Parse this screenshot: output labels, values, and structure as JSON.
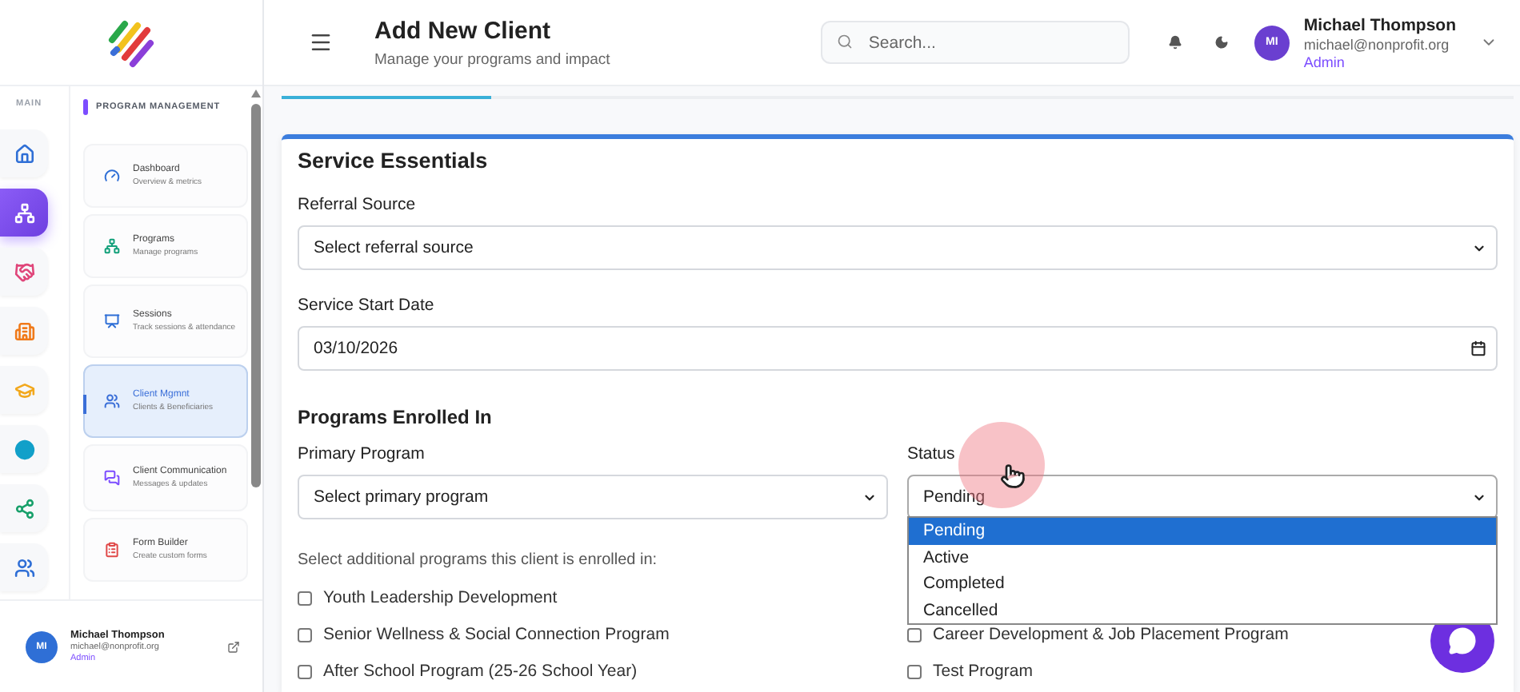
{
  "rail": {
    "label": "MAIN",
    "items": [
      {
        "kind": "home",
        "selected": false
      },
      {
        "kind": "programs",
        "selected": true
      },
      {
        "kind": "handshake",
        "selected": false
      },
      {
        "kind": "building",
        "selected": false
      },
      {
        "kind": "education",
        "selected": false
      },
      {
        "kind": "globe",
        "selected": false
      },
      {
        "kind": "network",
        "selected": false
      },
      {
        "kind": "people",
        "selected": false
      }
    ]
  },
  "nav": {
    "heading": "PROGRAM MANAGEMENT",
    "items": [
      {
        "kind": "dashboard",
        "title": "Dashboard",
        "subtitle": "Overview & metrics",
        "selected": false
      },
      {
        "kind": "programs",
        "title": "Programs",
        "subtitle": "Manage programs",
        "selected": false
      },
      {
        "kind": "sessions",
        "title": "Sessions",
        "subtitle": "Track sessions & attendance",
        "selected": false
      },
      {
        "kind": "clients",
        "title": "Client Mgmnt",
        "subtitle": "Clients & Beneficiaries",
        "selected": true
      },
      {
        "kind": "communication",
        "title": "Client Communication",
        "subtitle": "Messages & updates",
        "selected": false
      },
      {
        "kind": "forms",
        "title": "Form Builder",
        "subtitle": "Create custom forms",
        "selected": false
      }
    ]
  },
  "sidebar_user": {
    "initials": "MI",
    "name": "Michael Thompson",
    "email": "michael@nonprofit.org",
    "role": "Admin"
  },
  "header": {
    "title": "Add New Client",
    "subtitle": "Manage your programs and impact",
    "search": {
      "placeholder": "Search..."
    },
    "user": {
      "initials": "MI",
      "name": "Michael Thompson",
      "email": "michael@nonprofit.org",
      "role": "Admin"
    }
  },
  "progress": {
    "level": 0.17
  },
  "card": {
    "title": "Service Essentials",
    "referral": {
      "label": "Referral Source",
      "placeholder": "Select referral source"
    },
    "start_date": {
      "label": "Service Start Date",
      "value": "03/10/2026"
    },
    "section": "Programs Enrolled In",
    "primary": {
      "label": "Primary Program",
      "placeholder": "Select primary program"
    },
    "status": {
      "label": "Status",
      "value": "Pending",
      "open": true,
      "options": [
        {
          "label": "Pending",
          "selected": true
        },
        {
          "label": "Active",
          "selected": false
        },
        {
          "label": "Completed",
          "selected": false
        },
        {
          "label": "Cancelled",
          "selected": false
        }
      ]
    },
    "additional_hint": "Select additional programs this client is enrolled in:",
    "programs_left": [
      {
        "label": "Youth Leadership Development",
        "checked": false
      },
      {
        "label": "Senior Wellness & Social Connection Program",
        "checked": false
      },
      {
        "label": "After School Program (25-26 School Year)",
        "checked": false
      }
    ],
    "programs_right": [
      {
        "label": "Career Development & Job Placement Program",
        "checked": false
      },
      {
        "label": "Test Program",
        "checked": false
      }
    ]
  }
}
